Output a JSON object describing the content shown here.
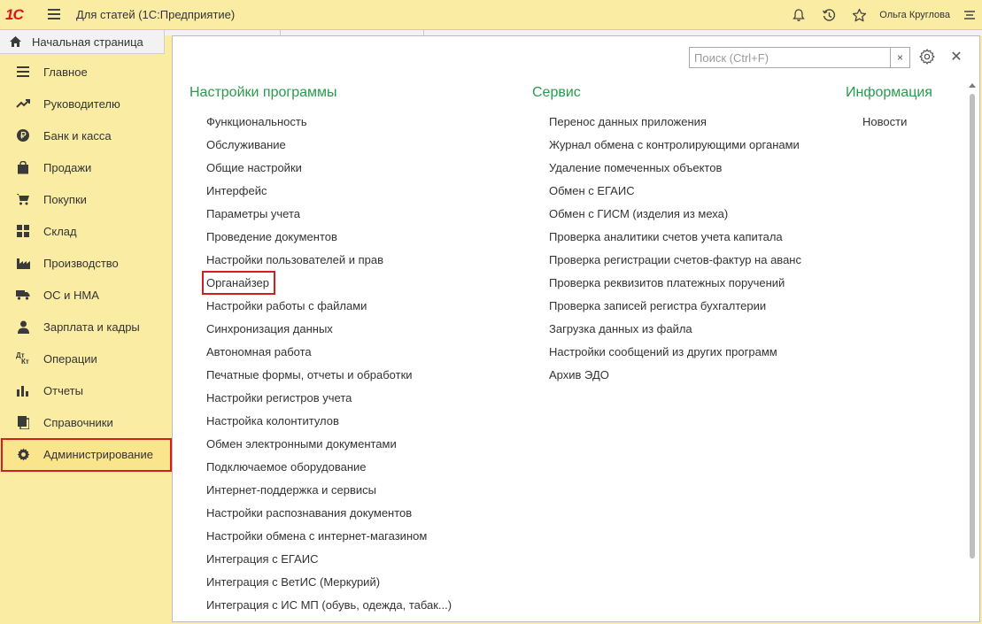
{
  "app": {
    "logo_text": "1С",
    "title": "Для статей  (1С:Предприятие)",
    "user_name": "Ольга Круглова"
  },
  "home_tab": {
    "label": "Начальная страница"
  },
  "sidebar": {
    "items": [
      {
        "label": "Главное",
        "icon": "list-icon"
      },
      {
        "label": "Руководителю",
        "icon": "trend-icon"
      },
      {
        "label": "Банк и касса",
        "icon": "ruble-icon"
      },
      {
        "label": "Продажи",
        "icon": "bag-icon"
      },
      {
        "label": "Покупки",
        "icon": "cart-icon"
      },
      {
        "label": "Склад",
        "icon": "grid-icon"
      },
      {
        "label": "Производство",
        "icon": "factory-icon"
      },
      {
        "label": "ОС и НМА",
        "icon": "truck-icon"
      },
      {
        "label": "Зарплата и кадры",
        "icon": "person-icon"
      },
      {
        "label": "Операции",
        "icon": "dt-kt-icon"
      },
      {
        "label": "Отчеты",
        "icon": "bar-chart-icon"
      },
      {
        "label": "Справочники",
        "icon": "book-icon"
      },
      {
        "label": "Администрирование",
        "icon": "gear-icon",
        "active": true
      }
    ],
    "dt_text": "Дт",
    "kt_text": "Кт"
  },
  "panel": {
    "search_placeholder": "Поиск (Ctrl+F)",
    "clear_label": "×",
    "close_label": "✕",
    "columns": [
      {
        "title": "Настройки программы",
        "items": [
          "Функциональность",
          "Обслуживание",
          "Общие настройки",
          "Интерфейс",
          "Параметры учета",
          "Проведение документов",
          "Настройки пользователей и прав",
          "Органайзер",
          "Настройки работы с файлами",
          "Синхронизация данных",
          "Автономная работа",
          "Печатные формы, отчеты и обработки",
          "Настройки регистров учета",
          "Настройка колонтитулов",
          "Обмен электронными документами",
          "Подключаемое оборудование",
          "Интернет-поддержка и сервисы",
          "Настройки распознавания документов",
          "Настройки обмена с интернет-магазином",
          "Интеграция с ЕГАИС",
          "Интеграция с ВетИС (Меркурий)",
          "Интеграция с ИС МП (обувь, одежда, табак...)"
        ]
      },
      {
        "title": "Сервис",
        "items": [
          "Перенос данных приложения",
          "Журнал обмена с контролирующими органами",
          "Удаление помеченных объектов",
          "Обмен с ЕГАИС",
          "Обмен с ГИСМ (изделия из меха)",
          "Проверка аналитики счетов учета капитала",
          "Проверка регистрации счетов-фактур на аванс",
          "Проверка реквизитов платежных поручений",
          "Проверка записей регистра бухгалтерии",
          "Загрузка данных из файла",
          "Настройки сообщений из других программ",
          "Архив ЭДО"
        ]
      },
      {
        "title": "Информация",
        "items": [
          "Новости"
        ]
      }
    ]
  },
  "colors": {
    "section_heading": "#2a9a4d",
    "sidebar_bg": "#fbeca4",
    "highlight_red": "#d01f1f"
  }
}
